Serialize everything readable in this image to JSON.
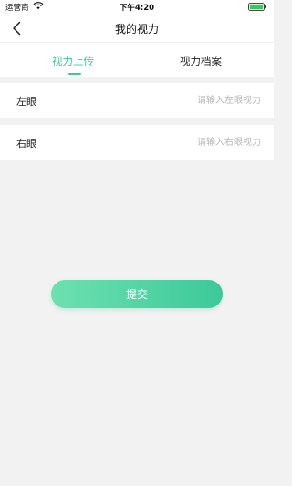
{
  "status_bar": {
    "carrier": "运营商",
    "time": "下午4:20",
    "wifi_icon": "wifi-icon",
    "battery_icon": "battery-icon"
  },
  "nav": {
    "title": "我的视力",
    "back_icon": "chevron-left-icon"
  },
  "tabs": [
    {
      "label": "视力上传",
      "active": true
    },
    {
      "label": "视力档案",
      "active": false
    }
  ],
  "form": {
    "left_eye": {
      "label": "左眼",
      "value": "",
      "placeholder": "请输入左眼视力"
    },
    "right_eye": {
      "label": "右眼",
      "value": "",
      "placeholder": "请输入右眼视力"
    }
  },
  "submit_label": "提交",
  "colors": {
    "accent": "#3cc99a",
    "accent_light": "#6ee0b0",
    "background": "#f2f2f2",
    "placeholder": "#b7b7b7"
  }
}
